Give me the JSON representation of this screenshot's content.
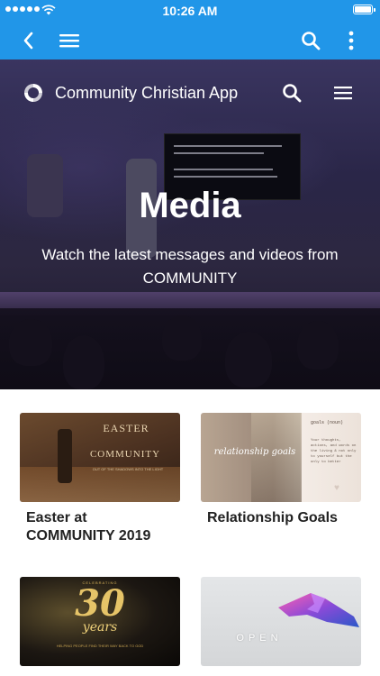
{
  "status_bar": {
    "time": "10:26 AM",
    "battery_level": 0.9
  },
  "app_bar": {
    "back": "back-arrow-icon",
    "menu": "hamburger-icon",
    "search": "search-icon",
    "more": "more-vertical-icon"
  },
  "hero": {
    "brand": "Community Christian App",
    "title": "Media",
    "subtitle": "Watch the latest messages and videos from COMMUNITY",
    "screen_lines": [
      "The further you get away from God,",
      "the more you will conform.",
      "The closer you get to God,",
      "the more your life will transform."
    ]
  },
  "cards": [
    {
      "title": "Easter at COMMUNITY 2019",
      "thumb_text": "EASTER",
      "thumb_text2": "COMMUNITY",
      "thumb_caption": "OUT OF THE SHADOWS INTO THE LIGHT"
    },
    {
      "title": "Relationship Goals",
      "thumb_text": "relationship goals",
      "thumb_note_title": "goals (noun)",
      "thumb_note": "Your thoughts, actions, and words on the living & not only to yourself but the only to better"
    },
    {
      "title": "",
      "thumb_top": "CELEBRATING",
      "thumb_number": "30",
      "thumb_word": "years",
      "thumb_caption": "HELPING PEOPLE FIND THEIR WAY BACK TO GOD"
    },
    {
      "title": "",
      "thumb_text": "OPEN"
    }
  ],
  "colors": {
    "app_blue": "#2196e8",
    "hero_purple": "#3a3560",
    "card_title": "#222222"
  }
}
